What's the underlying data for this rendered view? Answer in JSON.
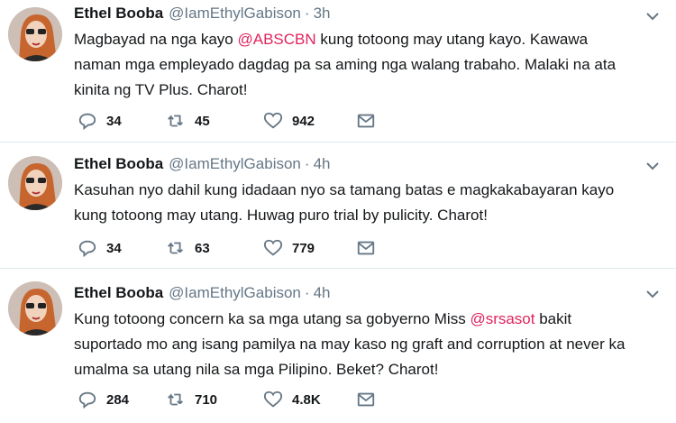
{
  "tweets": [
    {
      "name": "Ethel Booba",
      "handle": "@IamEthylGabison",
      "separator": "·",
      "time": "3h",
      "lines": [
        {
          "pre": "Magbayad na nga kayo ",
          "mention": "@ABSCBN",
          "post": " kung totoong may utang kayo. Kawawa"
        },
        {
          "pre": "naman mga empleyado dagdag pa sa aming nga walang trabaho. Malaki na ata",
          "mention": "",
          "post": ""
        },
        {
          "pre": "kinita ng TV Plus. Charot!",
          "mention": "",
          "post": ""
        }
      ],
      "replies": "34",
      "retweets": "45",
      "likes": "942"
    },
    {
      "name": "Ethel Booba",
      "handle": "@IamEthylGabison",
      "separator": "·",
      "time": "4h",
      "lines": [
        {
          "pre": "Kasuhan nyo dahil kung idadaan nyo sa tamang batas e magkakabayaran kayo",
          "mention": "",
          "post": ""
        },
        {
          "pre": "kung totoong may utang. Huwag puro trial by pulicity. Charot!",
          "mention": "",
          "post": ""
        }
      ],
      "replies": "34",
      "retweets": "63",
      "likes": "779"
    },
    {
      "name": "Ethel Booba",
      "handle": "@IamEthylGabison",
      "separator": "·",
      "time": "4h",
      "lines": [
        {
          "pre": "Kung totoong concern ka sa mga utang sa gobyerno Miss ",
          "mention": "@srsasot",
          "post": " bakit"
        },
        {
          "pre": "suportado mo ang isang pamilya na may kaso ng graft and corruption at never ka",
          "mention": "",
          "post": ""
        },
        {
          "pre": "umalma sa utang nila sa mga Pilipino. Beket? Charot!",
          "mention": "",
          "post": ""
        }
      ],
      "replies": "284",
      "retweets": "710",
      "likes": "4.8K"
    }
  ],
  "icons": {
    "reply": "reply-icon",
    "retweet": "retweet-icon",
    "like": "heart-icon",
    "dm": "envelope-icon",
    "caret": "chevron-down-icon"
  },
  "colors": {
    "mention": "#e0245e",
    "secondary_text": "#657786",
    "icon": "#657786",
    "divider": "#e1e8ed"
  }
}
